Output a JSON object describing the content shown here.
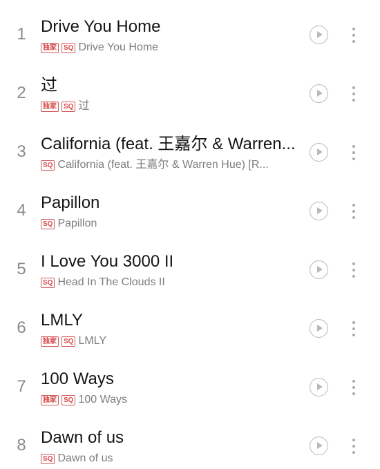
{
  "songs": [
    {
      "index": "1",
      "title": "Drive You Home",
      "badges": [
        "独家",
        "SQ"
      ],
      "subtitle": "Drive You Home"
    },
    {
      "index": "2",
      "title": "过",
      "badges": [
        "独家",
        "SQ"
      ],
      "subtitle": "过"
    },
    {
      "index": "3",
      "title": "California (feat. 王嘉尔 & Warren...",
      "badges": [
        "SQ"
      ],
      "subtitle": "California (feat. 王嘉尔 & Warren Hue) [R..."
    },
    {
      "index": "4",
      "title": "Papillon",
      "badges": [
        "SQ"
      ],
      "subtitle": "Papillon"
    },
    {
      "index": "5",
      "title": "I Love You 3000 II",
      "badges": [
        "SQ"
      ],
      "subtitle": "Head In The Clouds II"
    },
    {
      "index": "6",
      "title": "LMLY",
      "badges": [
        "独家",
        "SQ"
      ],
      "subtitle": "LMLY"
    },
    {
      "index": "7",
      "title": "100 Ways",
      "badges": [
        "独家",
        "SQ"
      ],
      "subtitle": "100 Ways"
    },
    {
      "index": "8",
      "title": "Dawn of us",
      "badges": [
        "SQ"
      ],
      "subtitle": "Dawn of us"
    }
  ],
  "icons": {
    "play": "play-icon",
    "more": "more-icon"
  },
  "colors": {
    "background": "#ffffff",
    "title_text": "#151515",
    "secondary_text": "#7d7d7d",
    "index_text": "#8a8a8a",
    "badge": "#d84a4a",
    "control_icon": "#b8b8b8"
  }
}
